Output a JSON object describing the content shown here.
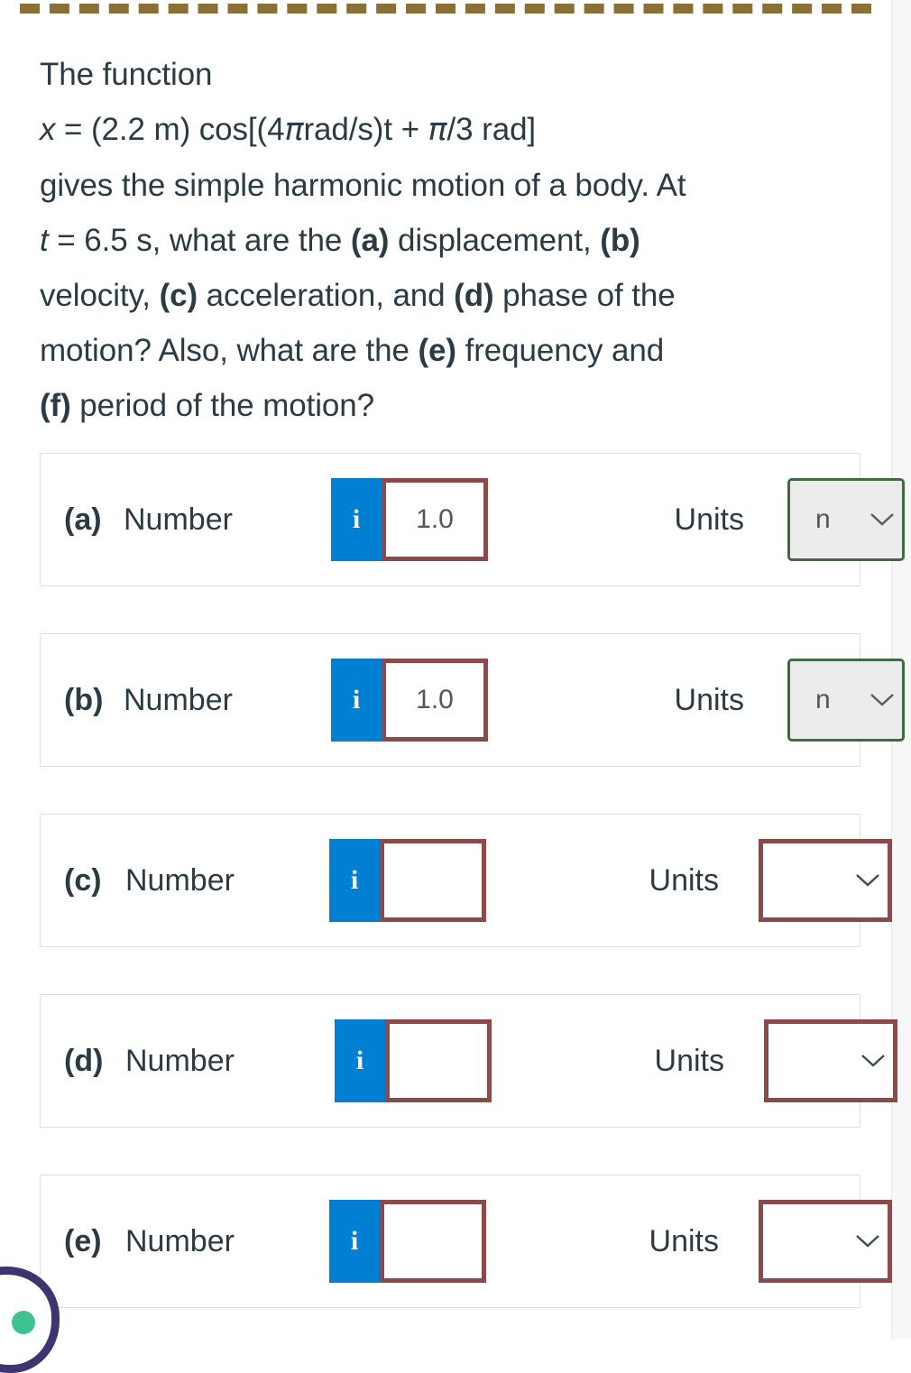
{
  "question": {
    "lines": [
      "The function",
      "x = (2.2 m) cos[(4πrad/s)t + π/3 rad]",
      "gives the simple harmonic motion of a body. At",
      "t = 6.5 s, what are the (a) displacement, (b)",
      "velocity, (c) acceleration, and (d) phase of the",
      "motion? Also, what are the (e) frequency and",
      "(f) period of the motion?"
    ],
    "l1": "The function",
    "l2_a": "x",
    "l2_b": " = (2.2 m) cos[(4",
    "l2_pi1": "π",
    "l2_c": "rad/s)t + ",
    "l2_pi2": "π",
    "l2_d": "/3 rad]",
    "l3": "gives the simple harmonic motion of a body. At",
    "l4_t": "t",
    "l4_a": " = 6.5 s, what are the ",
    "l4_b1": "(a)",
    "l4_b": " displacement, ",
    "l4_b2": "(b)",
    "l5_a": "velocity, ",
    "l5_b1": "(c)",
    "l5_b": " acceleration, and ",
    "l5_b2": "(d)",
    "l5_c": " phase of the",
    "l6_a": "motion? Also, what are the ",
    "l6_b1": "(e)",
    "l6_b": " frequency and",
    "l7_b1": "(f)",
    "l7_a": " period of the motion?"
  },
  "common": {
    "number_label": "Number",
    "units_label": "Units",
    "info_glyph": "i",
    "input_placeholder": ""
  },
  "colors": {
    "info_blue": "#0180d3",
    "error_red": "#8d4a4a",
    "correct_green": "#3f6b41",
    "text": "#2b3b44",
    "row_border": "#e0e0e0",
    "locked_fill": "#ececec",
    "dashed_rule": "#8a6f37",
    "badge_outline": "#3b3570",
    "badge_dot": "#3ec28f"
  },
  "rows": [
    {
      "id": "a",
      "part": "(a)",
      "number_label": "Number",
      "value": "1.0",
      "units_label": "Units",
      "unit_value": "n",
      "unit_state": "locked"
    },
    {
      "id": "b",
      "part": "(b)",
      "number_label": "Number",
      "value": "1.0",
      "units_label": "Units",
      "unit_value": "n",
      "unit_state": "locked"
    },
    {
      "id": "c",
      "part": "(c)",
      "number_label": "Number",
      "value": "",
      "units_label": "Units",
      "unit_value": "",
      "unit_state": "blank"
    },
    {
      "id": "d",
      "part": "(d)",
      "number_label": "Number",
      "value": "",
      "units_label": "Units",
      "unit_value": "",
      "unit_state": "blank"
    },
    {
      "id": "e",
      "part": "(e)",
      "number_label": "Number",
      "value": "",
      "units_label": "Units",
      "unit_value": "",
      "unit_state": "blank"
    }
  ]
}
